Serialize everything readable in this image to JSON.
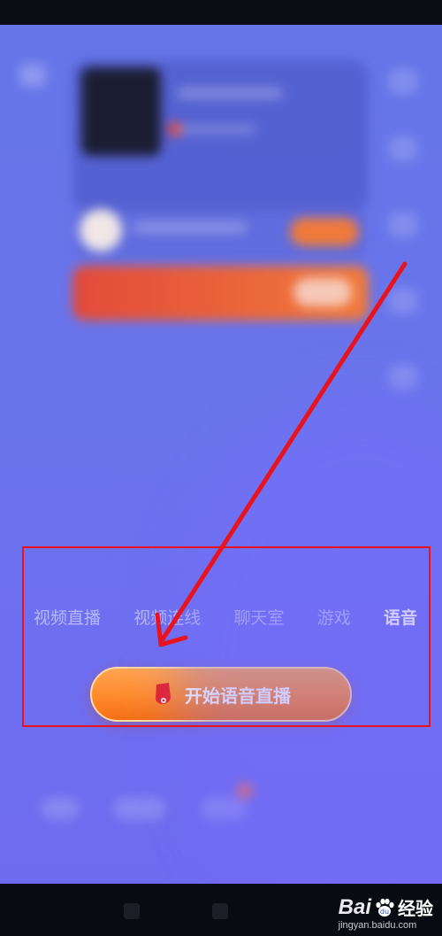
{
  "mode_tabs": [
    {
      "label": "视频直播",
      "active": false
    },
    {
      "label": "视频连线",
      "active": false
    },
    {
      "label": "聊天室",
      "active": false
    },
    {
      "label": "游戏",
      "active": false
    },
    {
      "label": "语音",
      "active": true
    }
  ],
  "start_button": {
    "label": "开始语音直播",
    "icon": "mic-icon"
  },
  "watermark": {
    "brand_text": "Bai",
    "brand_text_2": "经验",
    "url": "jingyan.baidu.com"
  },
  "colors": {
    "background": "#6a74ec",
    "button": "#ff8a2c",
    "annotation": "#e8131d"
  }
}
